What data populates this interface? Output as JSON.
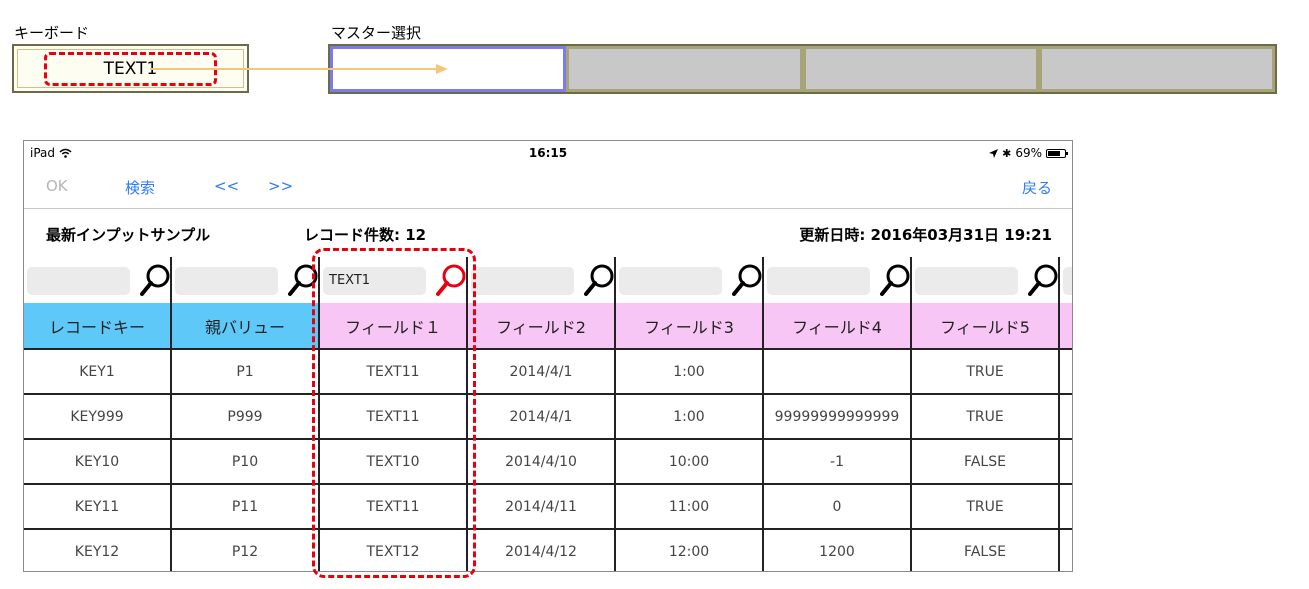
{
  "diagram": {
    "keyboard_label": "キーボード",
    "keyboard_value": "TEXT1",
    "master_label": "マスター選択"
  },
  "status_bar": {
    "device": "iPad",
    "time": "16:15",
    "battery": "69%"
  },
  "nav": {
    "ok": "OK",
    "search": "検索",
    "prev": "<<",
    "next": ">>",
    "back": "戻る"
  },
  "info": {
    "title": "最新インプットサンプル",
    "record_count": "レコード件数: 12",
    "updated": "更新日時: 2016年03月31日 19:21"
  },
  "search_values": [
    "",
    "",
    "TEXT1",
    "",
    "",
    "",
    ""
  ],
  "headers": [
    "レコードキー",
    "親バリュー",
    "フィールド１",
    "フィールド2",
    "フィールド3",
    "フィールド4",
    "フィールド5"
  ],
  "rows": [
    [
      "KEY1",
      "P1",
      "TEXT11",
      "2014/4/1",
      "1:00",
      "",
      "TRUE"
    ],
    [
      "KEY999",
      "P999",
      "TEXT11",
      "2014/4/1",
      "1:00",
      "99999999999999",
      "TRUE"
    ],
    [
      "KEY10",
      "P10",
      "TEXT10",
      "2014/4/10",
      "10:00",
      "-1",
      "FALSE"
    ],
    [
      "KEY11",
      "P11",
      "TEXT11",
      "2014/4/11",
      "11:00",
      "0",
      "TRUE"
    ],
    [
      "KEY12",
      "P12",
      "TEXT12",
      "2014/4/12",
      "12:00",
      "1200",
      "FALSE"
    ]
  ],
  "colors": {
    "key_header": "#5ec8f8",
    "field_header": "#f8c6f5",
    "link_blue": "#2e7cf6",
    "highlight_red": "#e8000f",
    "arrow": "#f5c57a"
  }
}
